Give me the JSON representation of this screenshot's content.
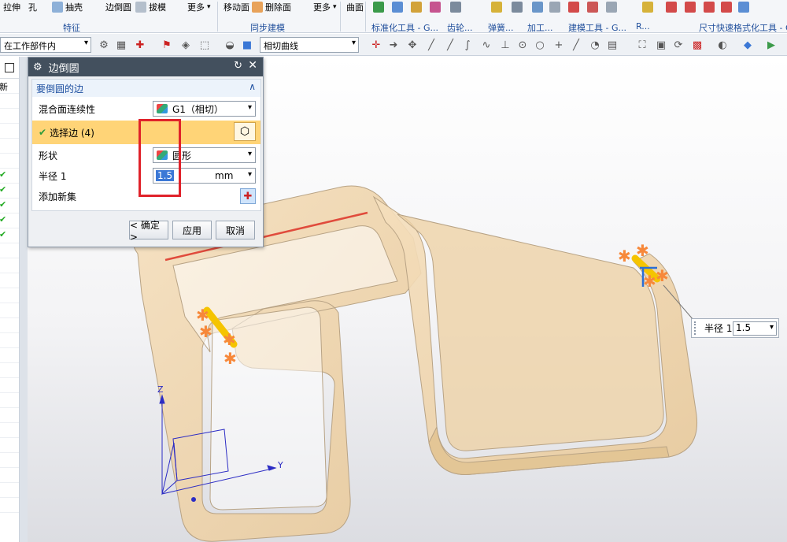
{
  "ribbon": {
    "items": [
      {
        "name": "ribbon-item-stretch",
        "label": "拉伸"
      },
      {
        "name": "ribbon-item-hole",
        "label": "孔"
      },
      {
        "name": "ribbon-item-shell",
        "label": "抽壳"
      },
      {
        "name": "ribbon-item-edge-blend",
        "label": "边倒圆"
      },
      {
        "name": "ribbon-item-draft",
        "label": "拔模"
      },
      {
        "name": "ribbon-item-more-1",
        "label": "更多"
      },
      {
        "name": "ribbon-item-move-face",
        "label": "移动面"
      },
      {
        "name": "ribbon-item-delete-face",
        "label": "删除面"
      },
      {
        "name": "ribbon-item-more-2",
        "label": "更多"
      },
      {
        "name": "ribbon-item-surface",
        "label": "曲面"
      }
    ],
    "groups": [
      {
        "name": "group-feature",
        "label": "特征"
      },
      {
        "name": "group-sync-modeling",
        "label": "同步建模"
      },
      {
        "name": "group-std-tools",
        "label": "标准化工具 - G..."
      },
      {
        "name": "group-gear",
        "label": "齿轮..."
      },
      {
        "name": "group-spring",
        "label": "弹簧..."
      },
      {
        "name": "group-machining",
        "label": "加工..."
      },
      {
        "name": "group-modeling-tools",
        "label": "建模工具 - G..."
      },
      {
        "name": "group-more-r",
        "label": "R..."
      },
      {
        "name": "group-dim-format",
        "label": "尺寸快速格式化工具 - GC"
      }
    ]
  },
  "toolbar": {
    "scope_combo": "在工作部件内",
    "curve_rule_combo": "相切曲线"
  },
  "navigator": {
    "header_text": "更新"
  },
  "dialog": {
    "title": "边倒圆",
    "section_title": "要倒圆的边",
    "continuity_label": "混合面连续性",
    "continuity_value": "G1（相切）",
    "select_edge_label": "选择边 (4)",
    "shape_label": "形状",
    "shape_value": "圆形",
    "radius_label": "半径 1",
    "radius_value": "1.5",
    "radius_unit": "mm",
    "add_set_label": "添加新集",
    "ok_label": "< 确定 >",
    "apply_label": "应用",
    "cancel_label": "取消"
  },
  "viewport": {
    "radius_tag_label": "半径 1",
    "radius_tag_value": "1.5",
    "axes": {
      "z": "Z",
      "y": "Y"
    }
  },
  "colors": {
    "dialog_title_bg": "#43505e",
    "selected_row": "#ffd477",
    "annotation": "#e0222a",
    "model_body": "#f2d9b4",
    "highlight_edge": "#f5c400",
    "handle_marker": "#f7883a"
  }
}
